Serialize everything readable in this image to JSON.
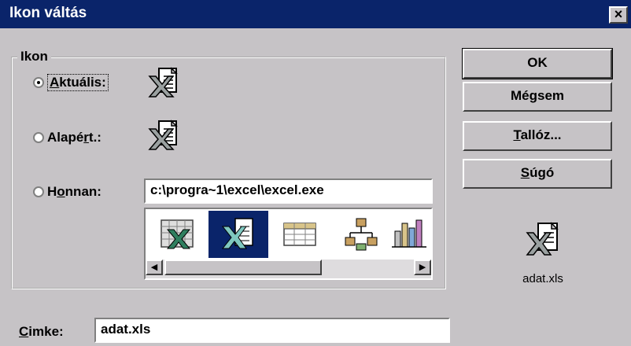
{
  "window": {
    "title": "Ikon váltás",
    "close_glyph": "×"
  },
  "group": {
    "legend": "Ikon"
  },
  "options": {
    "current": {
      "label": "Aktuális:",
      "u": "A",
      "rest": "ktuális:",
      "selected": true
    },
    "default": {
      "label": "Alapért.:",
      "pre": "Alapé",
      "u": "r",
      "post": "t.:",
      "selected": false
    },
    "from": {
      "label": "Honnan:",
      "pre": "H",
      "u": "o",
      "post": "nnan:",
      "selected": false
    }
  },
  "path": {
    "value": "c:\\progra~1\\excel\\excel.exe"
  },
  "icon_list": {
    "items": [
      {
        "name": "excel-sheet-icon",
        "selected": false
      },
      {
        "name": "excel-doc-icon",
        "selected": true
      },
      {
        "name": "table-grid-icon",
        "selected": false
      },
      {
        "name": "org-chart-icon",
        "selected": false
      },
      {
        "name": "bar-chart-icon",
        "selected": false
      }
    ]
  },
  "buttons": {
    "ok": "OK",
    "cancel": "Mégsem",
    "browse": {
      "label": "Tallóz...",
      "u": "T",
      "rest": "allóz..."
    },
    "help": {
      "label": "Súgó",
      "u": "S",
      "rest": "úgó"
    }
  },
  "preview": {
    "filename": "adat.xls"
  },
  "caption": {
    "label": "Cimke:",
    "u": "C",
    "rest": "imke:",
    "value": "adat.xls"
  },
  "colors": {
    "titlebar": "#0a246a",
    "face": "#c6c3c6",
    "selection": "#0a246a"
  }
}
